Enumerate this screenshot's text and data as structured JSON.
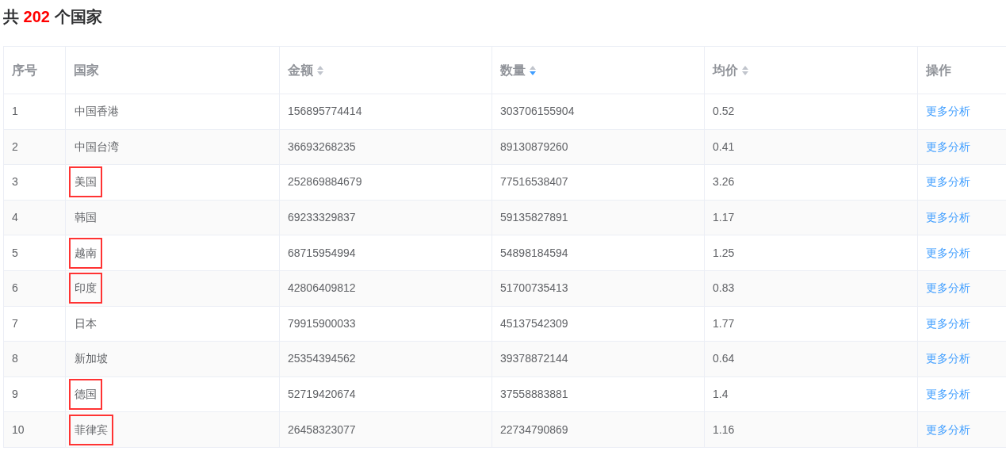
{
  "heading": {
    "prefix": "共",
    "count": "202",
    "suffix": "个国家"
  },
  "table": {
    "columns": [
      {
        "label": "序号",
        "sortable": false
      },
      {
        "label": "国家",
        "sortable": false
      },
      {
        "label": "金额",
        "sortable": true,
        "sorted_desc": false
      },
      {
        "label": "数量",
        "sortable": true,
        "sorted_desc": true
      },
      {
        "label": "均价",
        "sortable": true,
        "sorted_desc": false
      },
      {
        "label": "操作",
        "sortable": false
      }
    ],
    "rows": [
      {
        "index": "1",
        "country": "中国香港",
        "amount": "156895774414",
        "quantity": "303706155904",
        "avg_price": "0.52",
        "action": "更多分析",
        "highlighted": false
      },
      {
        "index": "2",
        "country": "中国台湾",
        "amount": "36693268235",
        "quantity": "89130879260",
        "avg_price": "0.41",
        "action": "更多分析",
        "highlighted": false
      },
      {
        "index": "3",
        "country": "美国",
        "amount": "252869884679",
        "quantity": "77516538407",
        "avg_price": "3.26",
        "action": "更多分析",
        "highlighted": true
      },
      {
        "index": "4",
        "country": "韩国",
        "amount": "69233329837",
        "quantity": "59135827891",
        "avg_price": "1.17",
        "action": "更多分析",
        "highlighted": false
      },
      {
        "index": "5",
        "country": "越南",
        "amount": "68715954994",
        "quantity": "54898184594",
        "avg_price": "1.25",
        "action": "更多分析",
        "highlighted": true
      },
      {
        "index": "6",
        "country": "印度",
        "amount": "42806409812",
        "quantity": "51700735413",
        "avg_price": "0.83",
        "action": "更多分析",
        "highlighted": true
      },
      {
        "index": "7",
        "country": "日本",
        "amount": "79915900033",
        "quantity": "45137542309",
        "avg_price": "1.77",
        "action": "更多分析",
        "highlighted": false
      },
      {
        "index": "8",
        "country": "新加坡",
        "amount": "25354394562",
        "quantity": "39378872144",
        "avg_price": "0.64",
        "action": "更多分析",
        "highlighted": false
      },
      {
        "index": "9",
        "country": "德国",
        "amount": "52719420674",
        "quantity": "37558883881",
        "avg_price": "1.4",
        "action": "更多分析",
        "highlighted": true
      },
      {
        "index": "10",
        "country": "菲律宾",
        "amount": "26458323077",
        "quantity": "22734790869",
        "avg_price": "1.16",
        "action": "更多分析",
        "highlighted": true
      }
    ]
  }
}
